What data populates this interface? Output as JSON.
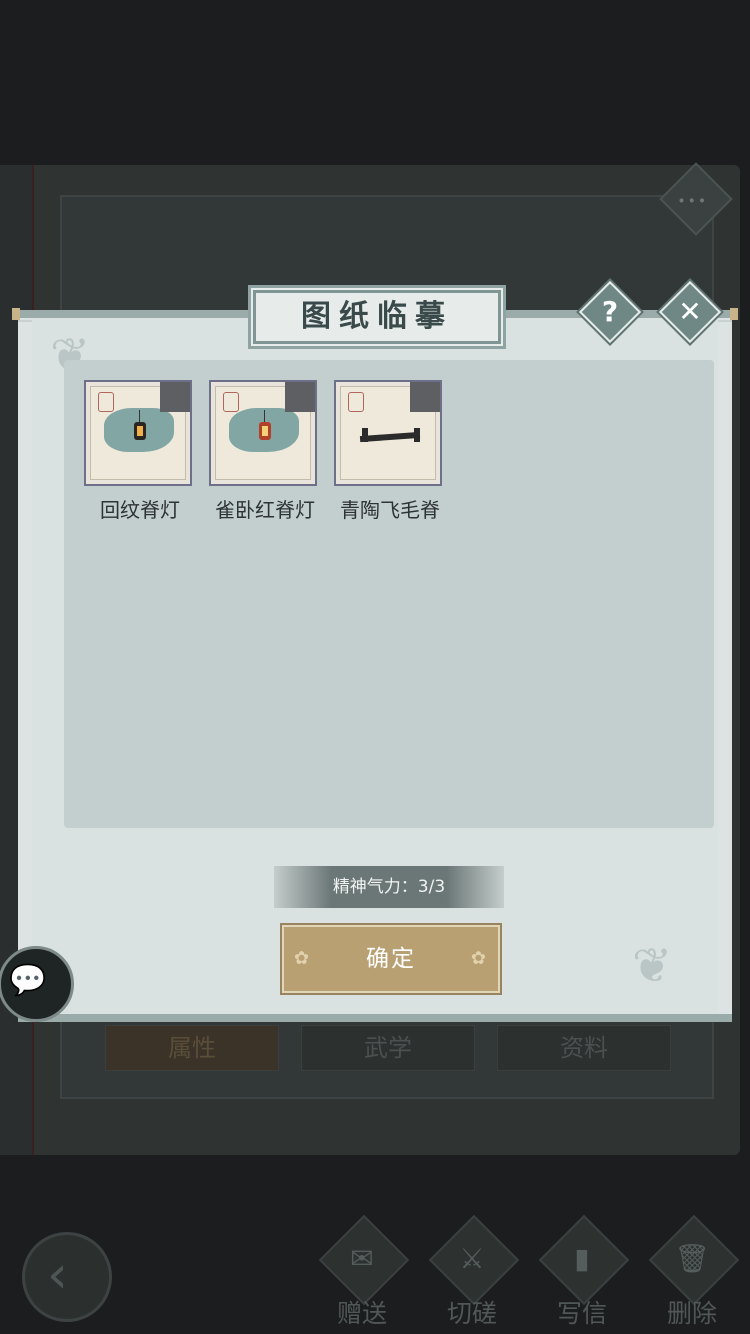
{
  "background": {
    "book_tabs": [
      "属性",
      "武学",
      "资料"
    ],
    "bottom_actions": [
      {
        "label": "赠送",
        "icon": "scroll-icon"
      },
      {
        "label": "切磋",
        "icon": "sword-icon"
      },
      {
        "label": "写信",
        "icon": "letter-icon"
      },
      {
        "label": "删除",
        "icon": "trash-icon"
      }
    ]
  },
  "dialog": {
    "title": "图纸临摹",
    "help": "?",
    "close": "✕",
    "items": [
      {
        "name": "回纹脊灯",
        "picture": "black-lantern"
      },
      {
        "name": "雀卧红脊灯",
        "picture": "red-lantern"
      },
      {
        "name": "青陶飞毛脊",
        "picture": "roof-ridge"
      }
    ],
    "energy": "精神气力：3/3",
    "confirm": "确定"
  },
  "colors": {
    "panel": "#dae2e1",
    "grid": "#c3cfcf",
    "confirm": "#b8a073",
    "frame": "#6e6f88"
  }
}
